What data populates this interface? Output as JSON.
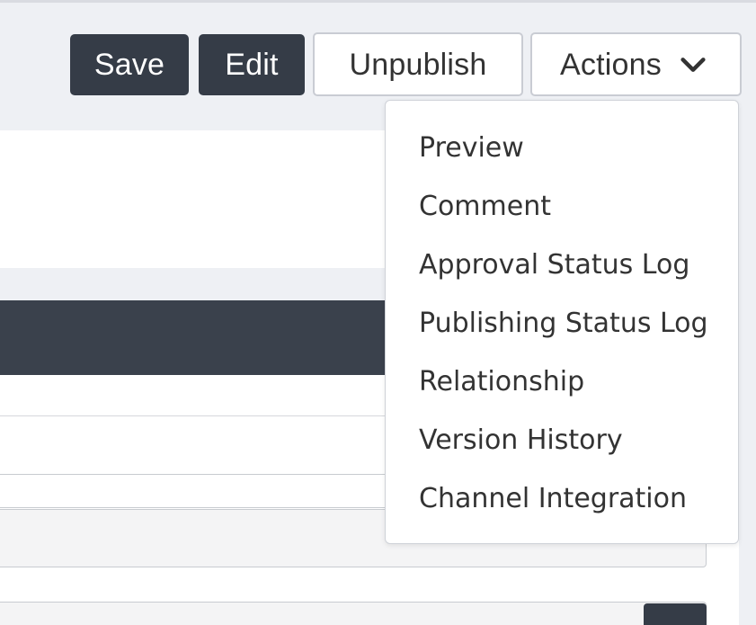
{
  "toolbar": {
    "save_label": "Save",
    "edit_label": "Edit",
    "unpublish_label": "Unpublish",
    "actions_label": "Actions"
  },
  "actions_menu": {
    "items": [
      {
        "label": "Preview"
      },
      {
        "label": "Comment"
      },
      {
        "label": "Approval Status Log"
      },
      {
        "label": "Publishing Status Log"
      },
      {
        "label": "Relationship"
      },
      {
        "label": "Version History"
      },
      {
        "label": "Channel Integration"
      }
    ]
  },
  "colors": {
    "dark_button": "#353c47",
    "dark_bar": "#3a414c",
    "page_background": "#eef0f4"
  },
  "icons": {
    "actions_chevron": "chevron-down-icon"
  }
}
